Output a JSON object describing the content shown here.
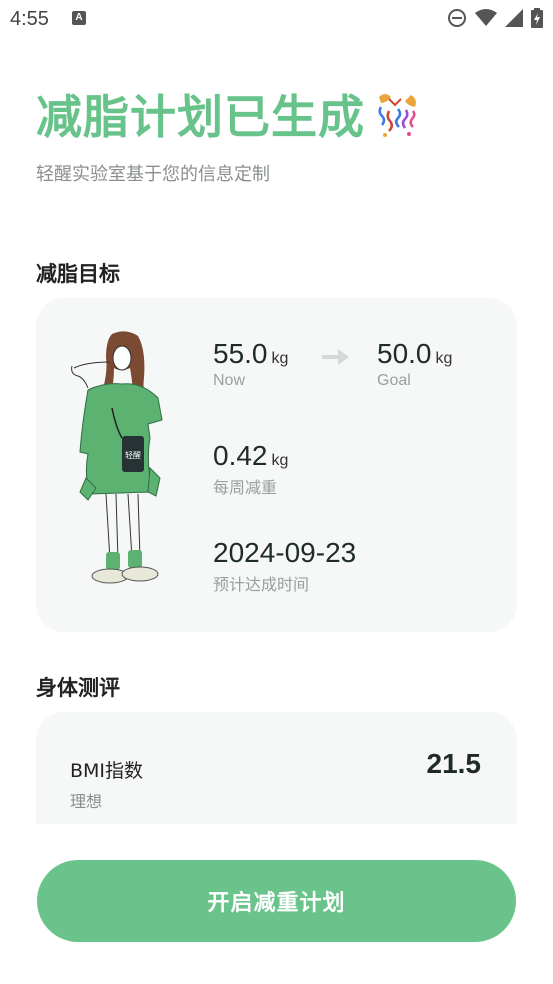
{
  "status_bar": {
    "time": "4:55",
    "badge": "A"
  },
  "hero": {
    "title": "减脂计划已生成",
    "subtitle": "轻醒实验室基于您的信息定制"
  },
  "goal_section": {
    "title": "减脂目标",
    "current": {
      "value": "55.0",
      "unit": "kg",
      "label": "Now"
    },
    "target": {
      "value": "50.0",
      "unit": "kg",
      "label": "Goal"
    },
    "weekly": {
      "value": "0.42",
      "unit": "kg",
      "label": "每周减重"
    },
    "eta": {
      "value": "2024-09-23",
      "label": "预计达成时间"
    },
    "bag_text": "轻醒"
  },
  "eval_section": {
    "title": "身体测评",
    "bmi": {
      "label": "BMI指数",
      "status": "理想",
      "value": "21.5"
    }
  },
  "cta": {
    "label": "开启减重计划"
  },
  "colors": {
    "accent": "#69c38a",
    "title": "#67c38a",
    "card": "#f6f8f7"
  }
}
